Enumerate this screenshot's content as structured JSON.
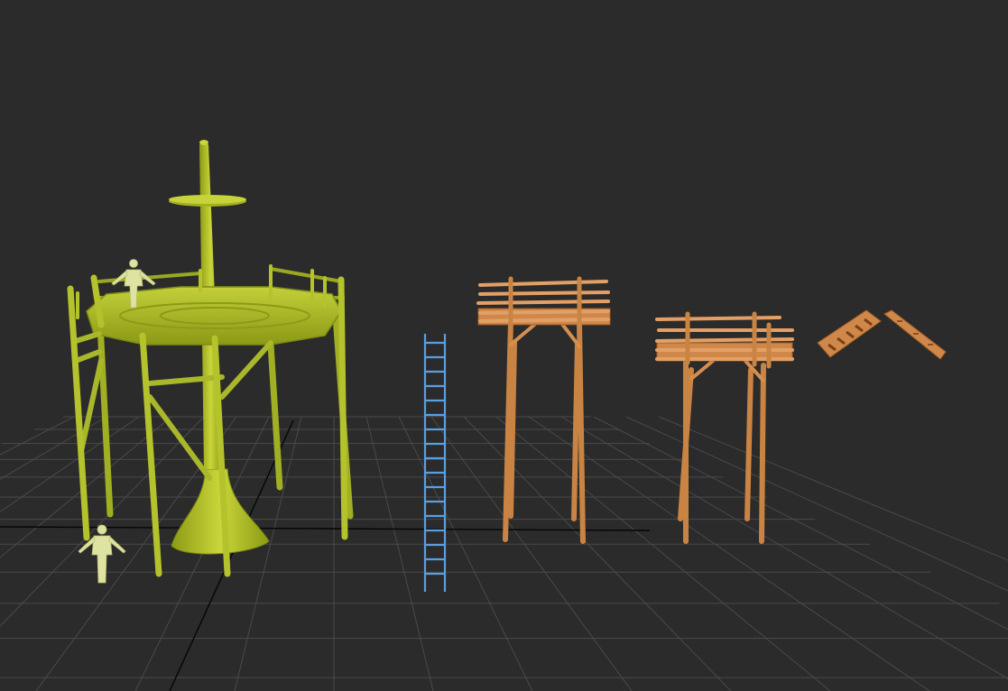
{
  "viewport": {
    "background": "#2b2b2b",
    "grid_color": "#4a4a4a",
    "axis_color": "#000000"
  },
  "objects": [
    {
      "name": "tree-watchtower-model",
      "color": "#b5c42b",
      "kind": "octagonal tower built around a tree trunk"
    },
    {
      "name": "human-scale-figure",
      "color": "#dfe3a2",
      "kind": "character reference mesh"
    },
    {
      "name": "ladder-model",
      "color": "#5a9fe0",
      "kind": "wooden ladder (selected)"
    },
    {
      "name": "tall-wooden-platform-model",
      "color": "#d0884a",
      "kind": "stilt platform"
    },
    {
      "name": "short-wooden-platform-model",
      "color": "#d0884a",
      "kind": "stilt platform"
    },
    {
      "name": "stair-piece-models",
      "color": "#d0884a",
      "kind": "stair segments"
    }
  ]
}
